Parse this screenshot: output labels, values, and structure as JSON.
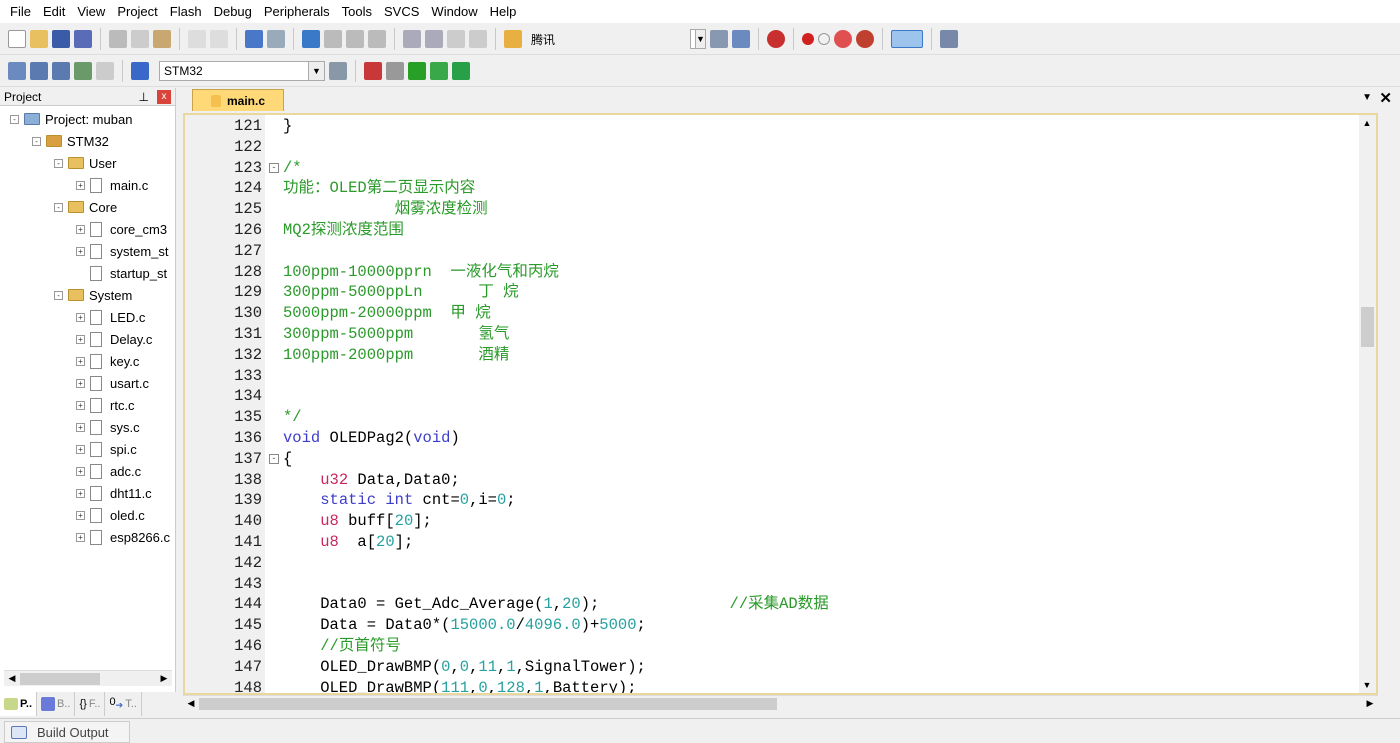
{
  "menu": [
    "File",
    "Edit",
    "View",
    "Project",
    "Flash",
    "Debug",
    "Peripherals",
    "Tools",
    "SVCS",
    "Window",
    "Help"
  ],
  "toolbar": {
    "find_text": "腾讯",
    "target": "STM32"
  },
  "project_panel": {
    "title": "Project",
    "close": "x",
    "pin": "ᴾ",
    "tree": [
      {
        "label": "Project: muban",
        "level": 0,
        "type": "project",
        "exp": "-"
      },
      {
        "label": "STM32",
        "level": 1,
        "type": "target",
        "exp": "-"
      },
      {
        "label": "User",
        "level": 2,
        "type": "folder",
        "exp": "-"
      },
      {
        "label": "main.c",
        "level": 3,
        "type": "file",
        "exp": "+"
      },
      {
        "label": "Core",
        "level": 2,
        "type": "folder",
        "exp": "-"
      },
      {
        "label": "core_cm3",
        "level": 3,
        "type": "file",
        "exp": "+"
      },
      {
        "label": "system_st",
        "level": 3,
        "type": "file",
        "exp": "+"
      },
      {
        "label": "startup_st",
        "level": 3,
        "type": "file",
        "exp": ""
      },
      {
        "label": "System",
        "level": 2,
        "type": "folder",
        "exp": "-"
      },
      {
        "label": "LED.c",
        "level": 3,
        "type": "file",
        "exp": "+"
      },
      {
        "label": "Delay.c",
        "level": 3,
        "type": "file",
        "exp": "+"
      },
      {
        "label": "key.c",
        "level": 3,
        "type": "file",
        "exp": "+"
      },
      {
        "label": "usart.c",
        "level": 3,
        "type": "file",
        "exp": "+"
      },
      {
        "label": "rtc.c",
        "level": 3,
        "type": "file",
        "exp": "+"
      },
      {
        "label": "sys.c",
        "level": 3,
        "type": "file",
        "exp": "+"
      },
      {
        "label": "spi.c",
        "level": 3,
        "type": "file",
        "exp": "+"
      },
      {
        "label": "adc.c",
        "level": 3,
        "type": "file",
        "exp": "+"
      },
      {
        "label": "dht11.c",
        "level": 3,
        "type": "file",
        "exp": "+"
      },
      {
        "label": "oled.c",
        "level": 3,
        "type": "file",
        "exp": "+"
      },
      {
        "label": "esp8266.c",
        "level": 3,
        "type": "file",
        "exp": "+"
      }
    ],
    "tabs": [
      "P..",
      "B..",
      "F..",
      "T.."
    ]
  },
  "editor": {
    "tab": "main.c",
    "lines": [
      {
        "n": "121",
        "f": "",
        "t": [
          [
            "}",
            "pl"
          ]
        ]
      },
      {
        "n": "122",
        "f": "",
        "t": []
      },
      {
        "n": "123",
        "f": "-",
        "t": [
          [
            "/*",
            "cm"
          ]
        ]
      },
      {
        "n": "124",
        "f": "",
        "t": [
          [
            "功能：OLED第二页显示内容",
            "cm"
          ]
        ]
      },
      {
        "n": "125",
        "f": "",
        "t": [
          [
            "            烟雾浓度检测",
            "cm"
          ]
        ]
      },
      {
        "n": "126",
        "f": "",
        "t": [
          [
            "MQ2探测浓度范围",
            "cm"
          ]
        ]
      },
      {
        "n": "127",
        "f": "",
        "t": []
      },
      {
        "n": "128",
        "f": "",
        "t": [
          [
            "100ppm-10000pprn  一液化气和丙烷",
            "cm"
          ]
        ]
      },
      {
        "n": "129",
        "f": "",
        "t": [
          [
            "300ppm-5000ppLn      丁 烷",
            "cm"
          ]
        ]
      },
      {
        "n": "130",
        "f": "",
        "t": [
          [
            "5000ppm-20000ppm  甲 烷",
            "cm"
          ]
        ]
      },
      {
        "n": "131",
        "f": "",
        "t": [
          [
            "300ppm-5000ppm       氢气",
            "cm"
          ]
        ]
      },
      {
        "n": "132",
        "f": "",
        "t": [
          [
            "100ppm-2000ppm       酒精",
            "cm"
          ]
        ]
      },
      {
        "n": "133",
        "f": "",
        "t": []
      },
      {
        "n": "134",
        "f": "",
        "t": []
      },
      {
        "n": "135",
        "f": "",
        "t": [
          [
            "*/",
            "cm"
          ]
        ]
      },
      {
        "n": "136",
        "f": "",
        "t": [
          [
            "void",
            "kw"
          ],
          [
            " OLEDPag2(",
            "pl"
          ],
          [
            "void",
            "kw"
          ],
          [
            ")",
            "pl"
          ]
        ]
      },
      {
        "n": "137",
        "f": "-",
        "t": [
          [
            "{",
            "pl"
          ]
        ]
      },
      {
        "n": "138",
        "f": "",
        "t": [
          [
            "    ",
            "pl"
          ],
          [
            "u32",
            "ty"
          ],
          [
            " Data,Data0;",
            "pl"
          ]
        ]
      },
      {
        "n": "139",
        "f": "",
        "t": [
          [
            "    ",
            "pl"
          ],
          [
            "static",
            "kw"
          ],
          [
            " ",
            "pl"
          ],
          [
            "int",
            "kw"
          ],
          [
            " cnt=",
            "pl"
          ],
          [
            "0",
            "nu"
          ],
          [
            ",i=",
            "pl"
          ],
          [
            "0",
            "nu"
          ],
          [
            ";",
            "pl"
          ]
        ]
      },
      {
        "n": "140",
        "f": "",
        "t": [
          [
            "    ",
            "pl"
          ],
          [
            "u8",
            "ty"
          ],
          [
            " buff[",
            "pl"
          ],
          [
            "20",
            "nu"
          ],
          [
            "];",
            "pl"
          ]
        ]
      },
      {
        "n": "141",
        "f": "",
        "t": [
          [
            "    ",
            "pl"
          ],
          [
            "u8",
            "ty"
          ],
          [
            "  a[",
            "pl"
          ],
          [
            "20",
            "nu"
          ],
          [
            "];",
            "pl"
          ]
        ]
      },
      {
        "n": "142",
        "f": "",
        "t": []
      },
      {
        "n": "143",
        "f": "",
        "t": []
      },
      {
        "n": "144",
        "f": "",
        "t": [
          [
            "    Data0 = Get_Adc_Average(",
            "pl"
          ],
          [
            "1",
            "nu"
          ],
          [
            ",",
            "pl"
          ],
          [
            "20",
            "nu"
          ],
          [
            ");              ",
            "pl"
          ],
          [
            "//采集AD数据",
            "cm"
          ]
        ]
      },
      {
        "n": "145",
        "f": "",
        "t": [
          [
            "    Data = Data0*(",
            "pl"
          ],
          [
            "15000.0",
            "nu"
          ],
          [
            "/",
            "pl"
          ],
          [
            "4096.0",
            "nu"
          ],
          [
            ")+",
            "pl"
          ],
          [
            "5000",
            "nu"
          ],
          [
            ";",
            "pl"
          ]
        ]
      },
      {
        "n": "146",
        "f": "",
        "t": [
          [
            "    ",
            "pl"
          ],
          [
            "//页首符号",
            "cm"
          ]
        ]
      },
      {
        "n": "147",
        "f": "",
        "t": [
          [
            "    OLED_DrawBMP(",
            "pl"
          ],
          [
            "0",
            "nu"
          ],
          [
            ",",
            "pl"
          ],
          [
            "0",
            "nu"
          ],
          [
            ",",
            "pl"
          ],
          [
            "11",
            "nu"
          ],
          [
            ",",
            "pl"
          ],
          [
            "1",
            "nu"
          ],
          [
            ",SignalTower);",
            "pl"
          ]
        ]
      },
      {
        "n": "148",
        "f": "",
        "t": [
          [
            "    OLED_DrawBMP(",
            "pl"
          ],
          [
            "111",
            "nu"
          ],
          [
            ",",
            "pl"
          ],
          [
            "0",
            "nu"
          ],
          [
            ",",
            "pl"
          ],
          [
            "128",
            "nu"
          ],
          [
            ",",
            "pl"
          ],
          [
            "1",
            "nu"
          ],
          [
            ",Battery);",
            "pl"
          ]
        ]
      }
    ]
  },
  "build_output": "Build Output"
}
